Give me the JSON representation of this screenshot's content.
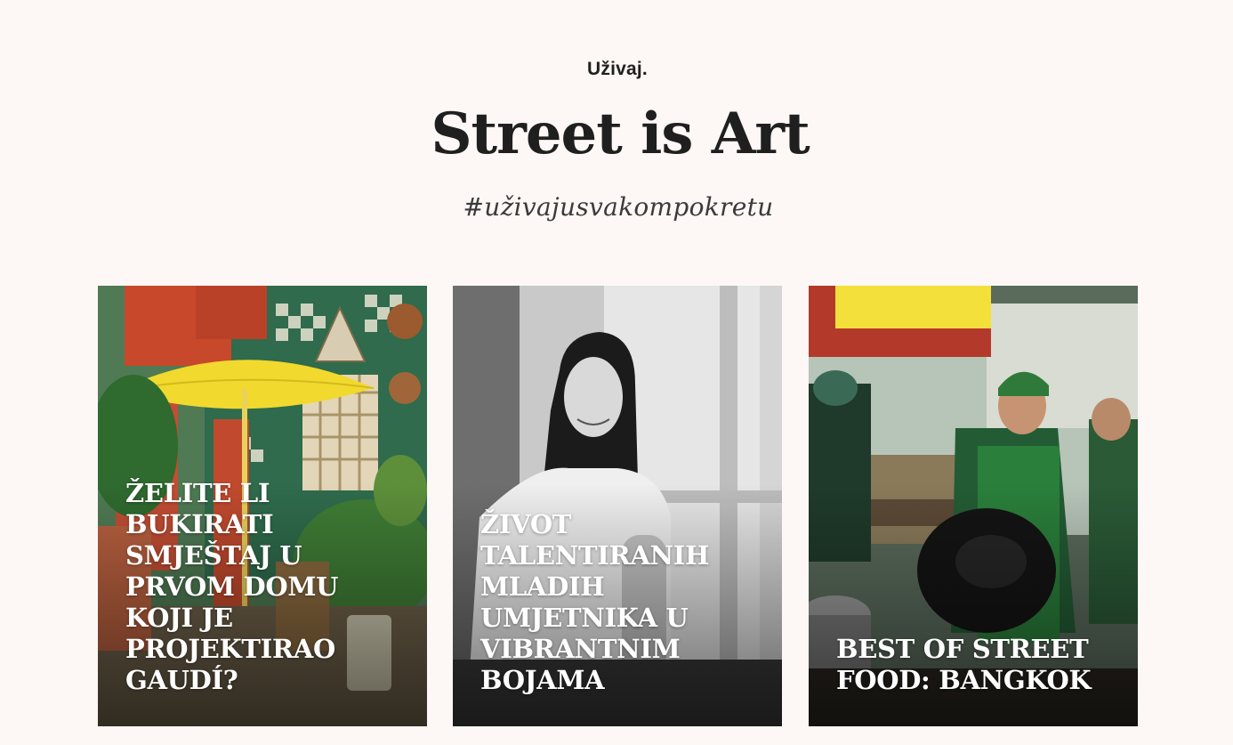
{
  "header": {
    "eyebrow": "Uživaj.",
    "title": "Street is Art",
    "hashtag": "#uživajusvakompokretu"
  },
  "cards": [
    {
      "caption": "Želite li bukirati smještaj u prvom domu koji je projektirao Gaudí?"
    },
    {
      "caption": "Život talentiranih mladih umjetnika u vibrantnim bojama"
    },
    {
      "caption": "Best of street food: Bangkok"
    }
  ],
  "colors": {
    "page_background": "#fdf7f6",
    "text_dark": "#1f1f1f",
    "caption_text": "#ffffff"
  },
  "images": [
    {
      "description_icon": "gaudi-house-photo"
    },
    {
      "description_icon": "young-artist-portrait-photo"
    },
    {
      "description_icon": "bangkok-street-food-photo"
    }
  ]
}
